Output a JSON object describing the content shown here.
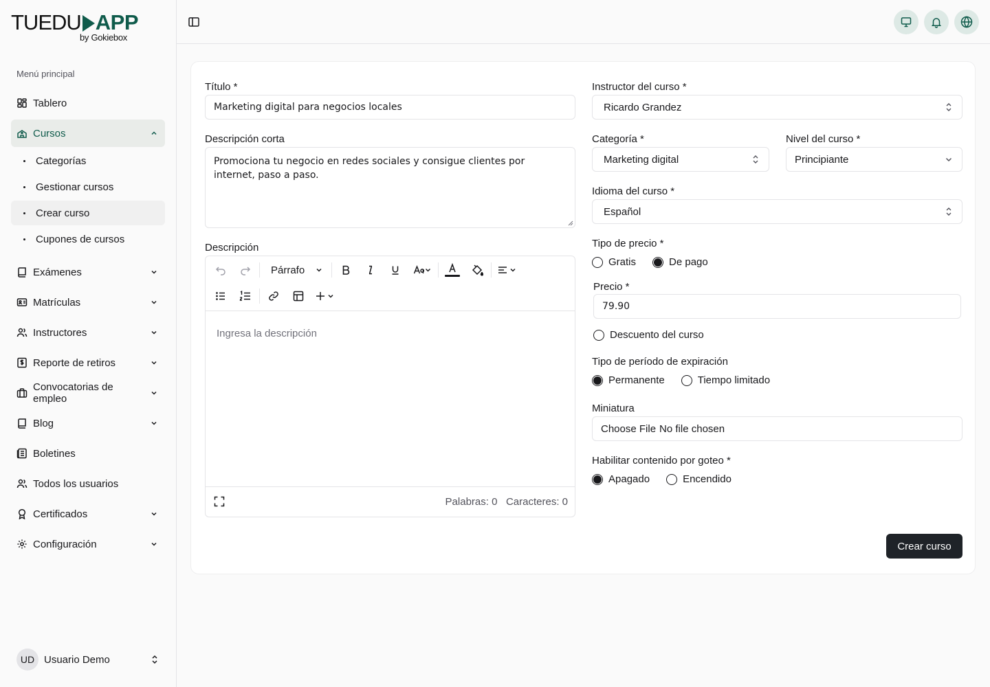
{
  "brand": {
    "name_part1": "TUEDU",
    "name_part2": "APP",
    "sub": "by Gokiebox",
    "accent": "#0f5b4b"
  },
  "sidebar": {
    "menu_title": "Menú principal",
    "items": [
      {
        "label": "Tablero",
        "icon": "dashboard-icon"
      },
      {
        "label": "Cursos",
        "icon": "school-icon",
        "active": true
      },
      {
        "label": "Exámenes",
        "icon": "book-icon"
      },
      {
        "label": "Matrículas",
        "icon": "id-card-icon"
      },
      {
        "label": "Instructores",
        "icon": "users-icon"
      },
      {
        "label": "Reporte de retiros",
        "icon": "dollar-icon"
      },
      {
        "label": "Convocatorias de empleo",
        "icon": "briefcase-icon"
      },
      {
        "label": "Blog",
        "icon": "book-icon"
      },
      {
        "label": "Boletines",
        "icon": "newsletter-icon"
      },
      {
        "label": "Todos los usuarios",
        "icon": "users-icon"
      },
      {
        "label": "Certificados",
        "icon": "award-icon"
      },
      {
        "label": "Configuración",
        "icon": "gear-icon"
      }
    ],
    "sub_items": [
      {
        "label": "Categorías"
      },
      {
        "label": "Gestionar cursos"
      },
      {
        "label": "Crear curso",
        "active": true
      },
      {
        "label": "Cupones de cursos"
      }
    ],
    "user": {
      "initials": "UD",
      "name": "Usuario Demo"
    }
  },
  "form": {
    "title_label": "Título *",
    "title_value": "Marketing digital para negocios locales",
    "short_desc_label": "Descripción corta",
    "short_desc_value": "Promociona tu negocio en redes sociales y consigue clientes por internet, paso a paso.",
    "desc_label": "Descripción",
    "editor": {
      "paragraph_label": "Párrafo",
      "placeholder": "Ingresa la descripción",
      "words": "Palabras: 0",
      "chars": "Caracteres: 0"
    },
    "instructor_label": "Instructor del curso *",
    "instructor_value": "Ricardo Grandez",
    "category_label": "Categoría *",
    "category_value": "Marketing digital",
    "level_label": "Nivel del curso *",
    "level_value": "Principiante",
    "language_label": "Idioma del curso *",
    "language_value": "Español",
    "price_type_label": "Tipo de precio *",
    "price_type_options": [
      "Gratis",
      "De pago"
    ],
    "price_type_selected": "De pago",
    "price_label": "Precio *",
    "price_value": "79.90",
    "discount_label": "Descuento del curso",
    "expiration_label": "Tipo de período de expiración",
    "expiration_options": [
      "Permanente",
      "Tiempo limitado"
    ],
    "expiration_selected": "Permanente",
    "thumbnail_label": "Miniatura",
    "thumbnail_button": "Choose File",
    "thumbnail_status": "No file chosen",
    "drip_label": "Habilitar contenido por goteo *",
    "drip_options": [
      "Apagado",
      "Encendido"
    ],
    "drip_selected": "Apagado",
    "submit_label": "Crear curso"
  }
}
